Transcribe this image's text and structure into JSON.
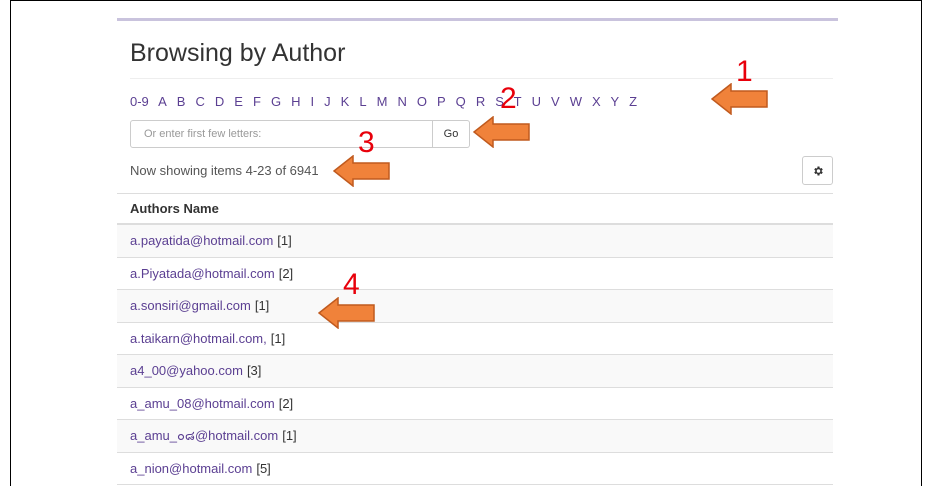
{
  "page_title": "Browsing by Author",
  "letters": [
    "0-9",
    "A",
    "B",
    "C",
    "D",
    "E",
    "F",
    "G",
    "H",
    "I",
    "J",
    "K",
    "L",
    "M",
    "N",
    "O",
    "P",
    "Q",
    "R",
    "S",
    "T",
    "U",
    "V",
    "W",
    "X",
    "Y",
    "Z"
  ],
  "search": {
    "placeholder": "Or enter first few letters:",
    "go_label": "Go"
  },
  "showing_text": "Now showing items 4-23 of 6941",
  "settings_icon": "gear-icon",
  "table": {
    "header": "Authors Name",
    "rows": [
      {
        "name": "a.payatida@hotmail.com",
        "count": "[1]"
      },
      {
        "name": "a.Piyatada@hotmail.com",
        "count": "[2]"
      },
      {
        "name": "a.sonsiri@gmail.com",
        "count": "[1]"
      },
      {
        "name": "a.taikarn@hotmail.com,",
        "count": "[1]"
      },
      {
        "name": "a4_00@yahoo.com",
        "count": "[3]"
      },
      {
        "name": "a_amu_08@hotmail.com",
        "count": "[2]"
      },
      {
        "name": "a_amu_๐๘@hotmail.com",
        "count": "[1]"
      },
      {
        "name": "a_nion@hotmail.com",
        "count": "[5]"
      }
    ]
  },
  "annotations": {
    "n1": "1",
    "n2": "2",
    "n3": "3",
    "n4": "4",
    "arrow_color": "#f0823a",
    "number_color": "#e8000b"
  }
}
